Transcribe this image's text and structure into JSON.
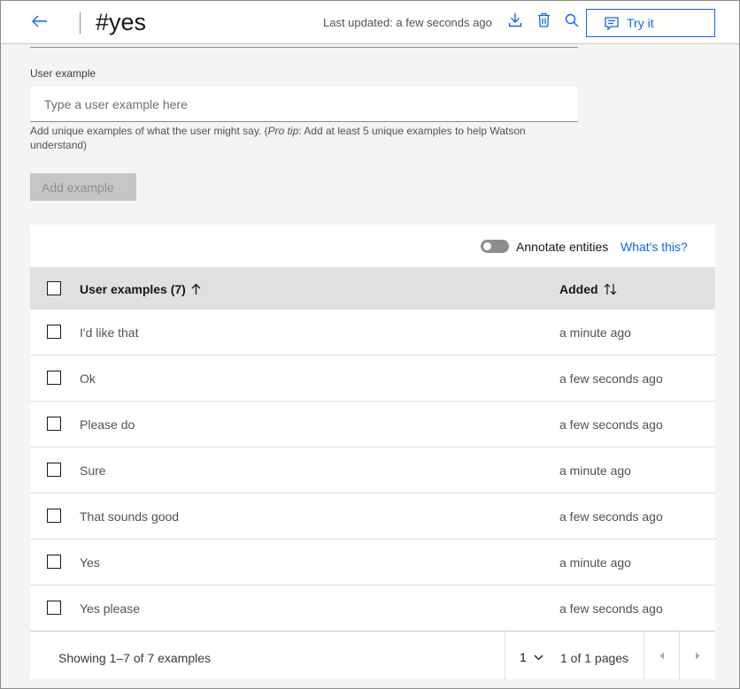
{
  "header": {
    "title": "#yes",
    "last_updated": "Last updated: a few seconds ago",
    "try_it_label": "Try it"
  },
  "icons": {
    "back": "arrow-left-icon",
    "download": "download-icon",
    "delete": "trash-icon",
    "search": "search-icon",
    "chat": "chat-icon"
  },
  "form": {
    "label": "User example",
    "placeholder": "Type a user example here",
    "value": "",
    "helper_prefix": "Add unique examples of what the user might say. (",
    "helper_italic": "Pro tip",
    "helper_suffix": ": Add at least 5 unique examples to help Watson understand)",
    "add_button_label": "Add example"
  },
  "table": {
    "annotate_label": "Annotate entities",
    "annotate_enabled": false,
    "whats_this_label": "What's this?",
    "columns": {
      "examples": "User examples (7)",
      "added": "Added"
    },
    "rows": [
      {
        "example": "I'd like that",
        "added": "a minute ago"
      },
      {
        "example": "Ok",
        "added": "a few seconds ago"
      },
      {
        "example": "Please do",
        "added": "a few seconds ago"
      },
      {
        "example": "Sure",
        "added": "a minute ago"
      },
      {
        "example": "That sounds good",
        "added": "a few seconds ago"
      },
      {
        "example": "Yes",
        "added": "a minute ago"
      },
      {
        "example": "Yes please",
        "added": "a few seconds ago"
      }
    ]
  },
  "pagination": {
    "showing": "Showing 1–7 of 7 examples",
    "current_page": "1",
    "of_pages": "1 of 1 pages"
  },
  "colors": {
    "accent": "#0f62fe",
    "header_bg": "#e0e0e0",
    "page_bg": "#f4f4f4",
    "disabled_bg": "#c6c6c6"
  }
}
